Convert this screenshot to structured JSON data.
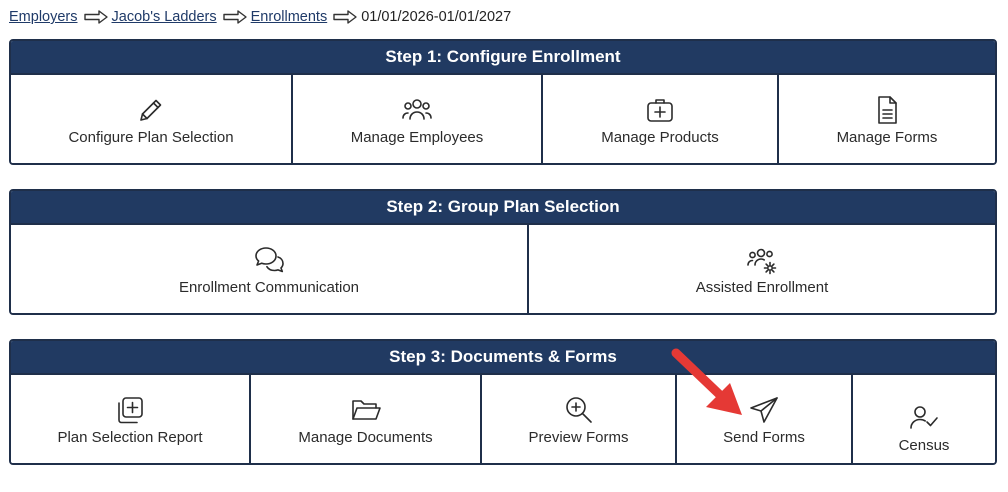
{
  "breadcrumb": {
    "items": [
      "Employers",
      "Jacob's Ladders",
      "Enrollments"
    ],
    "current": "01/01/2026-01/01/2027"
  },
  "steps": [
    {
      "title": "Step 1: Configure Enrollment",
      "tiles": [
        {
          "label": "Configure Plan Selection",
          "icon": "pencil-icon"
        },
        {
          "label": "Manage Employees",
          "icon": "users-icon"
        },
        {
          "label": "Manage Products",
          "icon": "medical-kit-icon"
        },
        {
          "label": "Manage Forms",
          "icon": "document-icon"
        }
      ]
    },
    {
      "title": "Step 2: Group Plan Selection",
      "tiles": [
        {
          "label": "Enrollment Communication",
          "icon": "chat-bubbles-icon"
        },
        {
          "label": "Assisted Enrollment",
          "icon": "users-gear-icon"
        }
      ]
    },
    {
      "title": "Step 3: Documents & Forms",
      "tiles": [
        {
          "label": "Plan Selection Report",
          "icon": "copy-plus-icon"
        },
        {
          "label": "Manage Documents",
          "icon": "folder-open-icon"
        },
        {
          "label": "Preview Forms",
          "icon": "zoom-in-icon"
        },
        {
          "label": "Send Forms",
          "icon": "paper-plane-icon"
        },
        {
          "label": "Census",
          "icon": "user-check-icon"
        }
      ]
    }
  ],
  "colors": {
    "header_bg": "#213a62",
    "border": "#1f2f4a",
    "link": "#1f3a68",
    "annotation_arrow": "#e53935"
  }
}
